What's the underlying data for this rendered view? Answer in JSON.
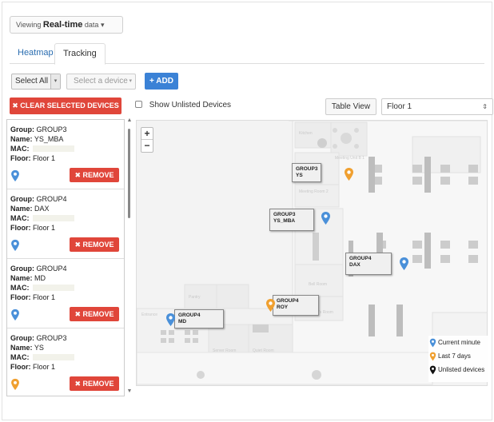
{
  "viewing": {
    "prefix": "Viewing",
    "mode": "Real-time",
    "suffix": "data",
    "caret": "▾"
  },
  "tabs": [
    {
      "label": "Heatmap"
    },
    {
      "label": "Tracking"
    }
  ],
  "filters": {
    "select_all": "Select All",
    "device_placeholder": "Select a device",
    "add_label": "+ ADD"
  },
  "clear_button": "✖ CLEAR SELECTED DEVICES",
  "show_unlisted": "Show Unlisted Devices",
  "table_view": "Table View",
  "floor": {
    "selected": "Floor 1",
    "caret": "⇕"
  },
  "devices": [
    {
      "group_label": "Group:",
      "group": "GROUP3",
      "name_label": "Name:",
      "name": "YS_MBA",
      "mac_label": "MAC:",
      "floor_label": "Floor:",
      "floor": "Floor 1",
      "status": "current",
      "remove": "✖ REMOVE"
    },
    {
      "group_label": "Group:",
      "group": "GROUP4",
      "name_label": "Name:",
      "name": "DAX",
      "mac_label": "MAC:",
      "floor_label": "Floor:",
      "floor": "Floor 1",
      "status": "current",
      "remove": "✖ REMOVE"
    },
    {
      "group_label": "Group:",
      "group": "GROUP4",
      "name_label": "Name:",
      "name": "MD",
      "mac_label": "MAC:",
      "floor_label": "Floor:",
      "floor": "Floor 1",
      "status": "current",
      "remove": "✖ REMOVE"
    },
    {
      "group_label": "Group:",
      "group": "GROUP3",
      "name_label": "Name:",
      "name": "YS",
      "mac_label": "MAC:",
      "floor_label": "Floor:",
      "floor": "Floor 1",
      "status": "last7",
      "remove": "✖ REMOVE"
    }
  ],
  "zoom": {
    "in": "+",
    "out": "−"
  },
  "map_tags": [
    {
      "group": "GROUP3",
      "name": "YS"
    },
    {
      "group": "GROUP3",
      "name": "YS_MBA"
    },
    {
      "group": "GROUP4",
      "name": "DAX"
    },
    {
      "group": "GROUP4",
      "name": "ROY"
    },
    {
      "group": "GROUP4",
      "name": "MD"
    }
  ],
  "legend": [
    {
      "label": "Current minute",
      "color": "#4a90d9"
    },
    {
      "label": "Last 7 days",
      "color": "#f0a030"
    },
    {
      "label": "Unlisted devices",
      "color": "#111111"
    }
  ],
  "colors": {
    "accent": "#3b82d6",
    "danger": "#e0463a",
    "pin_current": "#4a90d9",
    "pin_last7": "#f0a030"
  }
}
